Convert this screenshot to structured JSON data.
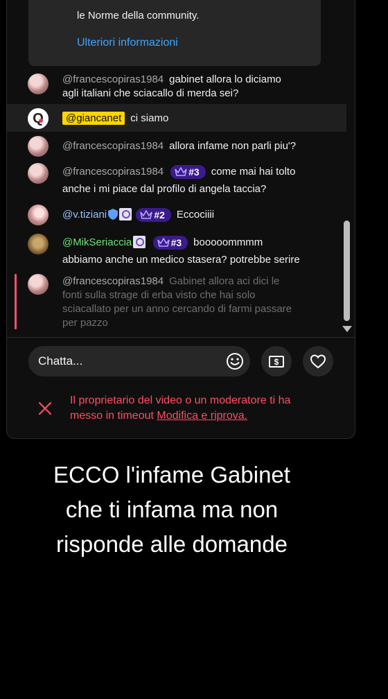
{
  "notice": {
    "text": "le Norme della community.",
    "link": "Ulteriori informazioni"
  },
  "messages": [
    {
      "author": "@francescopiras1984",
      "line1": "gabinet allora lo diciamo",
      "line2": "agli italiani che sciacallo di merda sei?"
    },
    {
      "author": "@giancanet",
      "text": "ci siamo"
    },
    {
      "author": "@francescopiras1984",
      "text": "allora infame non parli piu'?"
    },
    {
      "author": "@francescopiras1984",
      "badge": "#3",
      "line1": "come mai hai tolto",
      "line2": "anche i mi piace dal profilo di angela taccia?"
    },
    {
      "author": "@v.tiziani",
      "badge": "#2",
      "text": "Eccociiii"
    },
    {
      "author": "@MikSeriaccia",
      "badge": "#3",
      "line1": "booooommmm",
      "line2": "abbiamo anche un medico stasera? potrebbe serire"
    },
    {
      "author": "@francescopiras1984",
      "line1": "Gabinet allora aci dici le",
      "line2": "fonti sulla strage di erba visto che hai solo",
      "line3": "sciacallato per un anno cercando di farmi passare",
      "line4": "per pazzo"
    }
  ],
  "chat_input": {
    "placeholder": "Chatta..."
  },
  "timeout": {
    "line1": "Il proprietario del video o un moderatore ti ha",
    "line2_prefix": "messo in timeout",
    "edit_link": "Modifica e riprova."
  },
  "caption": {
    "line1": "ECCO l'infame Gabinet",
    "line2": "che ti infama ma non",
    "line3": "risponde alle domande"
  },
  "colors": {
    "accent_blue": "#3ea6ff",
    "error_red": "#ff4e63",
    "badge_purple": "#3a1b8a",
    "chip_yellow": "#ffd600"
  },
  "icons": [
    "crown-icon",
    "verified-shield-icon",
    "emoji-icon",
    "super-chat-icon",
    "heart-icon",
    "close-icon"
  ]
}
